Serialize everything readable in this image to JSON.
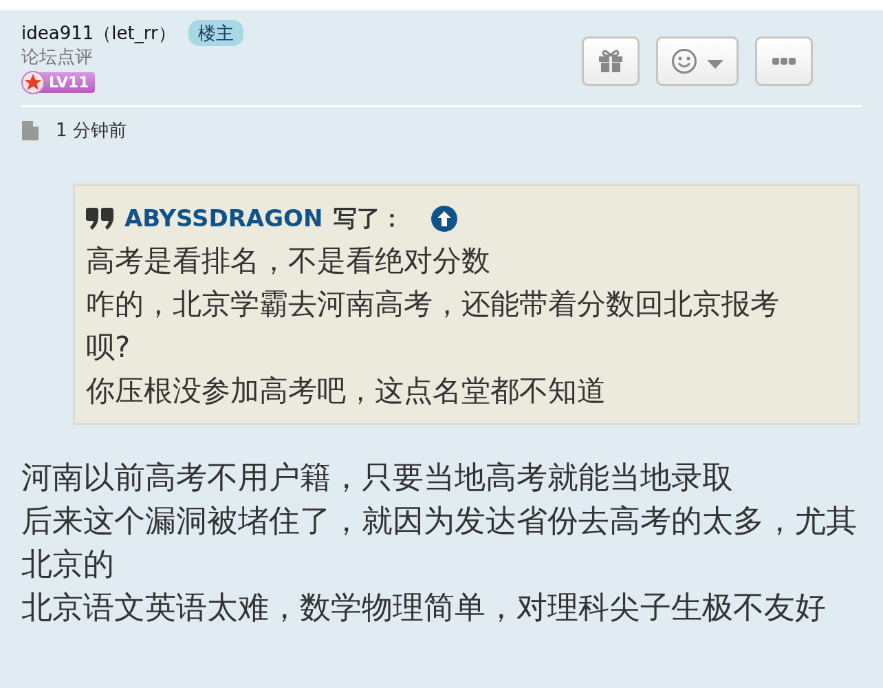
{
  "post": {
    "author": "idea911（let_rr）",
    "author_badge": "楼主",
    "author_group": "论坛点评",
    "rank": "LV11",
    "time": "1 分钟前"
  },
  "actions": [
    {
      "kind": "gift"
    },
    {
      "kind": "emoji"
    },
    {
      "kind": "more"
    }
  ],
  "quote": {
    "author": "ABYSSDRAGON",
    "suffix": "写了：",
    "lines": [
      "高考是看排名，不是看绝对分数",
      "咋的，北京学霸去河南高考，还能带着分数回北京报考呗?",
      "你压根没参加高考吧，这点名堂都不知道"
    ]
  },
  "body": [
    "河南以前高考不用户籍，只要当地高考就能当地录取",
    "后来这个漏洞被堵住了，就因为发达省份去高考的太多，尤其北京的",
    "北京语文英语太难，数学物理简单，对理科尖子生极不友好"
  ]
}
